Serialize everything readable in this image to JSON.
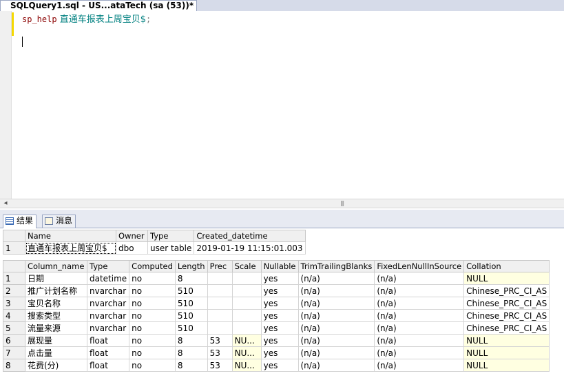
{
  "tab": {
    "title": "SQLQuery1.sql - US...ataTech (sa (53))*"
  },
  "editor": {
    "keyword": "sp_help",
    "object": "直通车报表上周宝贝$",
    "terminator": ";"
  },
  "result_tabs": [
    {
      "label": "结果",
      "icon": "grid-icon"
    },
    {
      "label": "消息",
      "icon": "message-icon"
    }
  ],
  "table1": {
    "headers": [
      "Name",
      "Owner",
      "Type",
      "Created_datetime"
    ],
    "rows": [
      [
        "1",
        "直通车报表上周宝贝$",
        "dbo",
        "user table",
        "2019-01-19 11:15:01.003"
      ]
    ]
  },
  "table2": {
    "headers": [
      "Column_name",
      "Type",
      "Computed",
      "Length",
      "Prec",
      "Scale",
      "Nullable",
      "TrimTrailingBlanks",
      "FixedLenNullInSource",
      "Collation"
    ],
    "rows": [
      [
        "1",
        "日期",
        "datetime",
        "no",
        "8",
        "",
        "",
        "yes",
        "(n/a)",
        "(n/a)",
        "NULL"
      ],
      [
        "2",
        "推广计划名称",
        "nvarchar",
        "no",
        "510",
        "",
        "",
        "yes",
        "(n/a)",
        "(n/a)",
        "Chinese_PRC_CI_AS"
      ],
      [
        "3",
        "宝贝名称",
        "nvarchar",
        "no",
        "510",
        "",
        "",
        "yes",
        "(n/a)",
        "(n/a)",
        "Chinese_PRC_CI_AS"
      ],
      [
        "4",
        "搜索类型",
        "nvarchar",
        "no",
        "510",
        "",
        "",
        "yes",
        "(n/a)",
        "(n/a)",
        "Chinese_PRC_CI_AS"
      ],
      [
        "5",
        "流量来源",
        "nvarchar",
        "no",
        "510",
        "",
        "",
        "yes",
        "(n/a)",
        "(n/a)",
        "Chinese_PRC_CI_AS"
      ],
      [
        "6",
        "展现量",
        "float",
        "no",
        "8",
        "53",
        "NU...",
        "yes",
        "(n/a)",
        "(n/a)",
        "NULL"
      ],
      [
        "7",
        "点击量",
        "float",
        "no",
        "8",
        "53",
        "NU...",
        "yes",
        "(n/a)",
        "(n/a)",
        "NULL"
      ],
      [
        "8",
        "花费(分)",
        "float",
        "no",
        "8",
        "53",
        "NU...",
        "yes",
        "(n/a)",
        "(n/a)",
        "NULL"
      ]
    ]
  }
}
